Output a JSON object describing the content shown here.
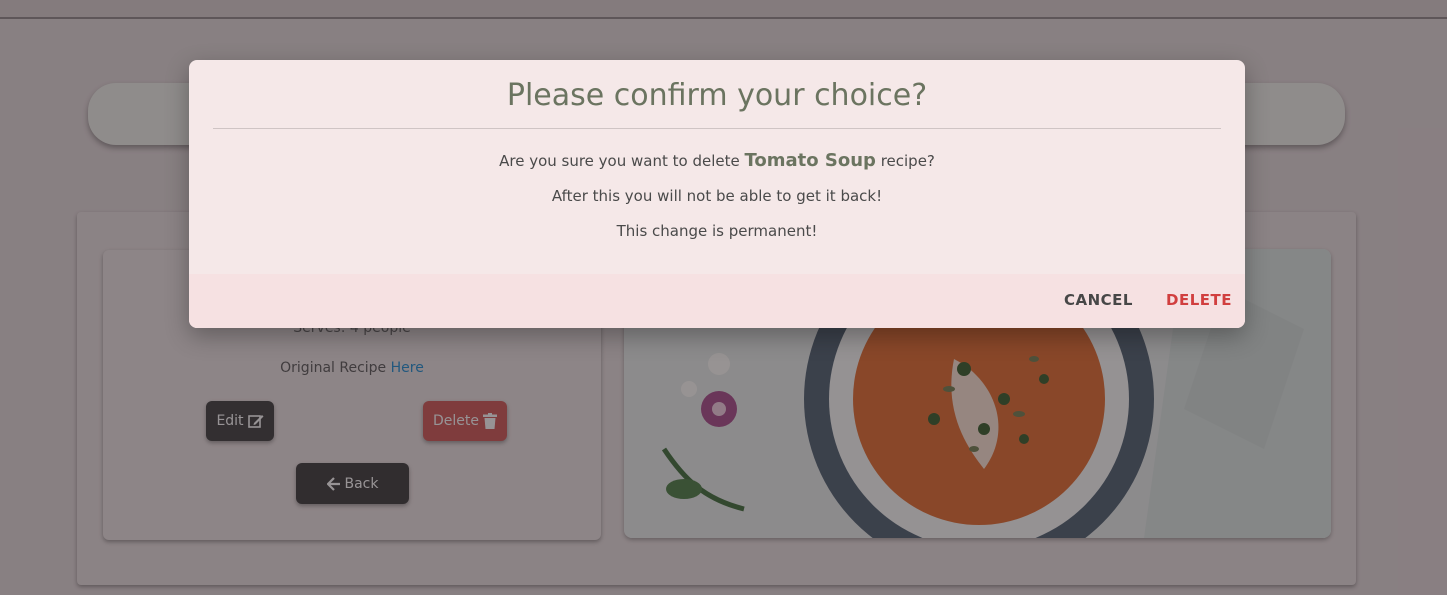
{
  "background": {
    "info": {
      "serves": "Serves: 4 people",
      "original_prefix": "Original Recipe",
      "original_link": "Here"
    },
    "buttons": {
      "edit_label": "Edit",
      "delete_label": "Delete",
      "back_label": "Back"
    }
  },
  "modal": {
    "title": "Please confirm your choice?",
    "line1_prefix": "Are you sure you want to delete",
    "recipe_name": "Tomato Soup",
    "line1_suffix": "recipe?",
    "line2": "After this you will not be able to get it back!",
    "line3": "This change is permanent!",
    "cancel_label": "CANCEL",
    "delete_label": "DELETE"
  },
  "colors": {
    "accent_olive": "#6b7460",
    "danger": "#d13f3f",
    "link": "#1e88c8",
    "modal_bg": "#f5e8e8"
  }
}
